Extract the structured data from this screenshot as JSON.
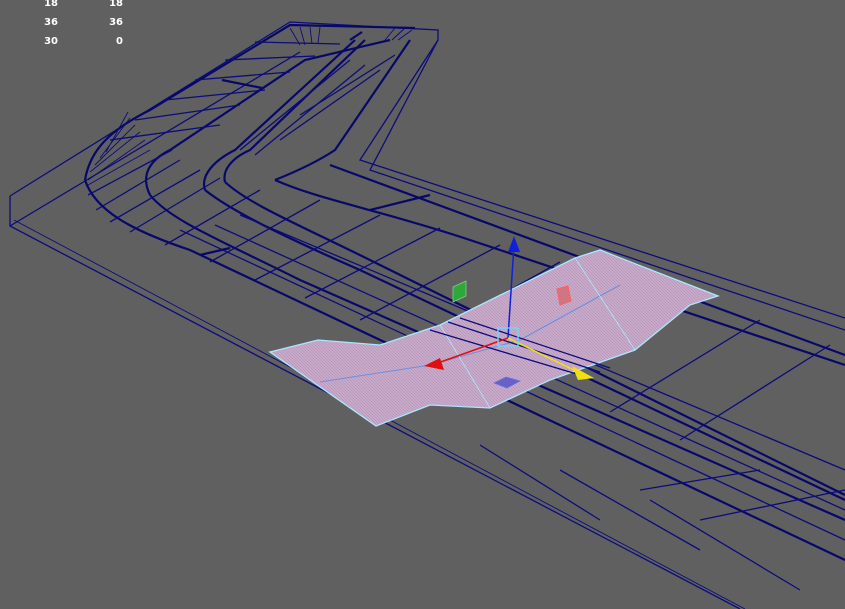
{
  "viewport": {
    "background": "#606060",
    "wire_color": "#0c0c7a",
    "selection_fill": "#c6a8c8",
    "selection_edge": "#a9e6ff"
  },
  "hud": {
    "rows": [
      {
        "a": "18",
        "b": "18"
      },
      {
        "a": "36",
        "b": "36"
      },
      {
        "a": "30",
        "b": "0"
      }
    ]
  },
  "manipulator": {
    "x_axis_color": "#e01010",
    "y_axis_color": "#1020d8",
    "z_axis_color": "#f0e010",
    "plane_handles": [
      "#2fa83a",
      "#d85050",
      "#5050c8"
    ]
  }
}
